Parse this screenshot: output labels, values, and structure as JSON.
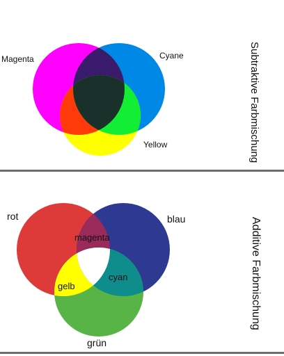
{
  "subtractive": {
    "title": "Subtraktive Farbmischung",
    "labels": {
      "magenta": "Magenta",
      "cyan": "Cyane",
      "yellow": "Yellow"
    },
    "colors": {
      "magenta": "#ff00ff",
      "cyan": "#0088e6",
      "yellow": "#ffff00",
      "magenta_cyan": "#3a1a6b",
      "magenta_yellow": "#ff3a0a",
      "cyan_yellow": "#11ee33",
      "center": "#1a302b"
    }
  },
  "additive": {
    "title": "Additive Farbmischung",
    "labels": {
      "red": "rot",
      "blue": "blau",
      "green": "grün",
      "magenta": "magenta",
      "yellow": "gelb",
      "cyan": "cyan"
    },
    "colors": {
      "red": "#de3a3a",
      "blue": "#2e3a92",
      "green": "#58b447",
      "magenta": "#9a2a5a",
      "yellow": "#ffff00",
      "cyan": "#0f8c8c",
      "center": "#ffffff"
    }
  },
  "divider_color": "#6e6e6e"
}
